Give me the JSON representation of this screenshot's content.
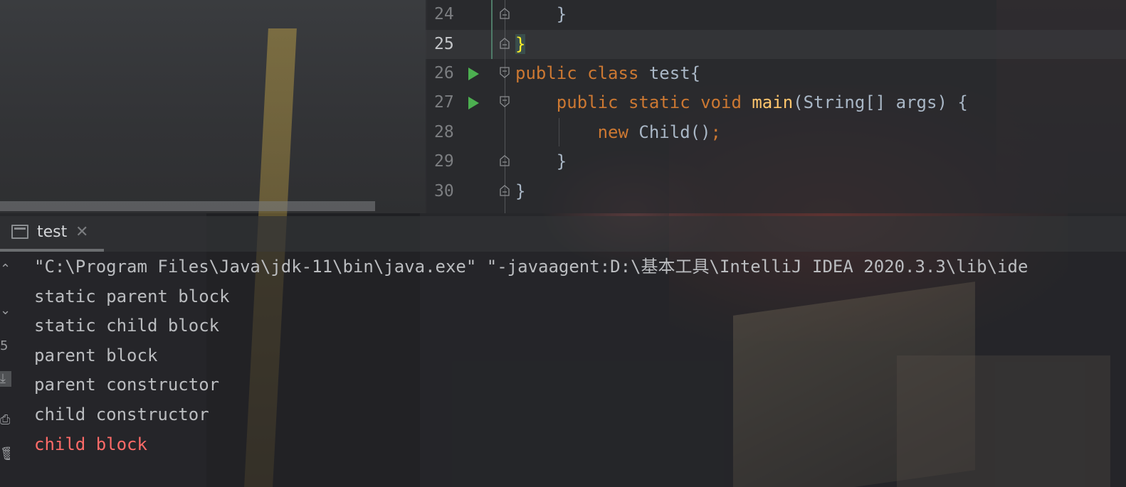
{
  "editor": {
    "lines": [
      {
        "num": "24",
        "code": "    }"
      },
      {
        "num": "25",
        "code": "}"
      },
      {
        "num": "26",
        "code": "public class test{"
      },
      {
        "num": "27",
        "code": "    public static void main(String[] args) {"
      },
      {
        "num": "28",
        "code": "        new Child();"
      },
      {
        "num": "29",
        "code": "    }"
      },
      {
        "num": "30",
        "code": "}"
      }
    ],
    "current_line": "25",
    "colors": {
      "keyword": "#cc7832",
      "method": "#ffc66d",
      "text": "#a9b7c6",
      "error": "#ff6b68"
    }
  },
  "run_tab": {
    "label": "test",
    "close": "✕"
  },
  "console": {
    "command": "\"C:\\Program Files\\Java\\jdk-11\\bin\\java.exe\" \"-javaagent:D:\\基本工具\\IntelliJ IDEA 2020.3.3\\lib\\ide",
    "output": [
      "static parent block",
      "static child block",
      "parent block",
      "parent constructor",
      "child constructor"
    ],
    "error_output": "child block"
  },
  "icons": [
    "run-gutter-icon",
    "fold-icon",
    "console-tab-icon",
    "close-icon",
    "scroll-to-end-icon",
    "print-icon",
    "delete-icon"
  ]
}
